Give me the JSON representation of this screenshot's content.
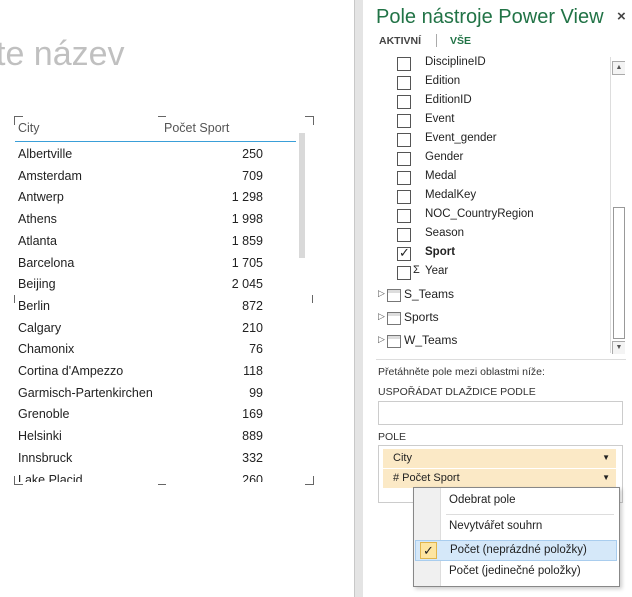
{
  "canvas": {
    "title_placeholder": "te název",
    "table": {
      "columns": [
        "City",
        "Počet Sport"
      ],
      "rows": [
        [
          "Albertville",
          "250"
        ],
        [
          "Amsterdam",
          "709"
        ],
        [
          "Antwerp",
          "1 298"
        ],
        [
          "Athens",
          "1 998"
        ],
        [
          "Atlanta",
          "1 859"
        ],
        [
          "Barcelona",
          "1 705"
        ],
        [
          "Beijing",
          "2 045"
        ],
        [
          "Berlin",
          "872"
        ],
        [
          "Calgary",
          "210"
        ],
        [
          "Chamonix",
          "76"
        ],
        [
          "Cortina d'Ampezzo",
          "118"
        ],
        [
          "Garmisch-Partenkirchen",
          "99"
        ],
        [
          "Grenoble",
          "169"
        ],
        [
          "Helsinki",
          "889"
        ],
        [
          "Innsbruck",
          "332"
        ],
        [
          "Lake Placid",
          "260"
        ]
      ]
    }
  },
  "pane": {
    "title": "Pole nástroje Power View",
    "close": "×",
    "tabs": [
      "AKTIVNÍ",
      "VŠE"
    ],
    "fields": [
      {
        "label": "DisciplineID",
        "checked": false
      },
      {
        "label": "Edition",
        "checked": false
      },
      {
        "label": "EditionID",
        "checked": false
      },
      {
        "label": "Event",
        "checked": false
      },
      {
        "label": "Event_gender",
        "checked": false
      },
      {
        "label": "Gender",
        "checked": false
      },
      {
        "label": "Medal",
        "checked": false
      },
      {
        "label": "MedalKey",
        "checked": false
      },
      {
        "label": "NOC_CountryRegion",
        "checked": false
      },
      {
        "label": "Season",
        "checked": false
      },
      {
        "label": "Sport",
        "checked": true
      },
      {
        "label": "Year",
        "checked": false,
        "sigma": "Σ"
      }
    ],
    "tables": [
      "S_Teams",
      "Sports",
      "W_Teams"
    ],
    "hint": "Přetáhněte pole mezi oblastmi níže:",
    "tile_by_label": "USPOŘÁDAT DLAŽDICE PODLE",
    "fields_label": "POLE",
    "field_chips": [
      "City",
      "# Počet Sport"
    ]
  },
  "context_menu": {
    "items": [
      "Odebrat pole",
      "Nevytvářet souhrn",
      "Počet (neprázdné položky)",
      "Počet (jedinečné položky)"
    ],
    "checked_index": 2,
    "check_glyph": "✓"
  },
  "colors": {
    "accent": "#217346",
    "header_line": "#3a9fd8",
    "chip": "#fbe9c6"
  }
}
